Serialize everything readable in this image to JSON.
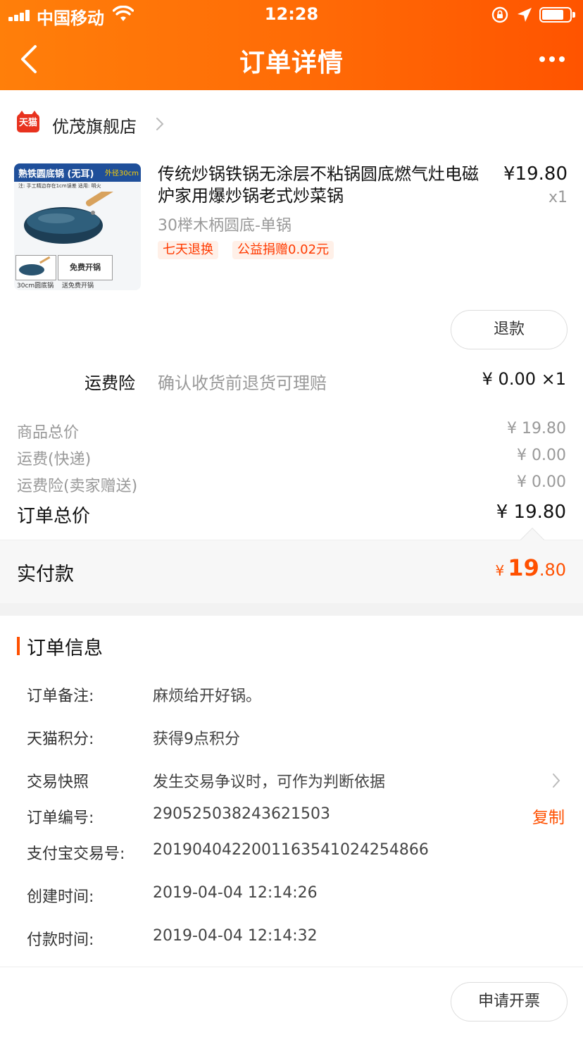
{
  "status_bar": {
    "carrier": "中国移动",
    "time": "12:28"
  },
  "nav": {
    "title": "订单详情",
    "back_icon": "chevron-left-icon",
    "more_icon": "more-dots-icon"
  },
  "shop": {
    "logo_text": "天猫",
    "name": "优茂旗舰店"
  },
  "product": {
    "thumb_banner_title": "熟铁圆底锅 (无耳)",
    "thumb_banner_size": "外径30cm",
    "thumb_note": "注: 手工精边存在1cm误差 适用: 明火",
    "thumb_box_label": "免费开锅",
    "thumb_caption_1": "30cm圆底锅",
    "thumb_caption_2": "送免费开锅",
    "title": "传统炒锅铁锅无涂层不粘锅圆底燃气灶电磁炉家用爆炒锅老式炒菜锅",
    "price": "¥19.80",
    "quantity": "x1",
    "spec": "30榉木柄圆底-单锅",
    "tags": [
      "七天退换",
      "公益捐赠0.02元"
    ],
    "refund_label": "退款"
  },
  "insurance": {
    "label": "运费险",
    "description": "确认收货前退货可理赔",
    "price": "¥ 0.00 ×1"
  },
  "summary": {
    "rows": [
      {
        "label": "商品总价",
        "value": "¥ 19.80"
      },
      {
        "label": "运费(快递)",
        "value": "¥ 0.00"
      },
      {
        "label": "运费险(卖家赠送)",
        "value": "¥ 0.00"
      }
    ],
    "total_label": "订单总价",
    "total_value": "¥ 19.80",
    "paid_label": "实付款",
    "paid_currency": "¥",
    "paid_integer": "19",
    "paid_decimal": ".80"
  },
  "order_info": {
    "title": "订单信息",
    "rows": [
      {
        "key": "订单备注:",
        "value": "麻烦给开好锅。"
      },
      {
        "key": "天猫积分:",
        "value": "获得9点积分"
      },
      {
        "key": "交易快照",
        "value": "发生交易争议时，可作为判断依据"
      },
      {
        "key": "订单编号:",
        "value": "290525038243621503"
      },
      {
        "key": "支付宝交易号:",
        "value": "2019040422001163541024254866"
      },
      {
        "key": "创建时间:",
        "value": "2019-04-04 12:14:26"
      },
      {
        "key": "付款时间:",
        "value": "2019-04-04 12:14:32"
      }
    ],
    "copy_label": "复制"
  },
  "footer": {
    "invoice_label": "申请开票"
  },
  "colors": {
    "header_start": "#ff7f0a",
    "header_end": "#ff5400",
    "accent": "#ff5000"
  }
}
